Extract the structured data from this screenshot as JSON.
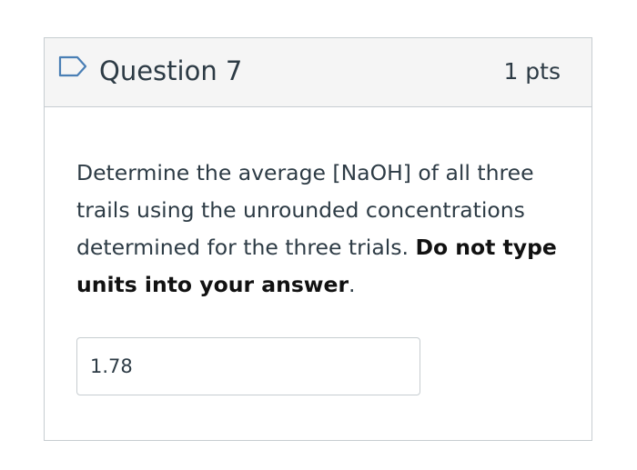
{
  "question": {
    "flag_icon": "flag-outline-icon",
    "title": "Question 7",
    "points": "1 pts",
    "text_before_bold": "Determine the average [NaOH] of all three trails using the unrounded concentrations determined for the three trials. ",
    "text_bold": "Do not type units into your answer",
    "text_after_bold": ".",
    "answer_value": "1.78"
  },
  "colors": {
    "header_background": "#f5f5f5",
    "border": "#c7cdd1",
    "flag_stroke": "#4a7fb5",
    "text": "#2d3b45"
  }
}
